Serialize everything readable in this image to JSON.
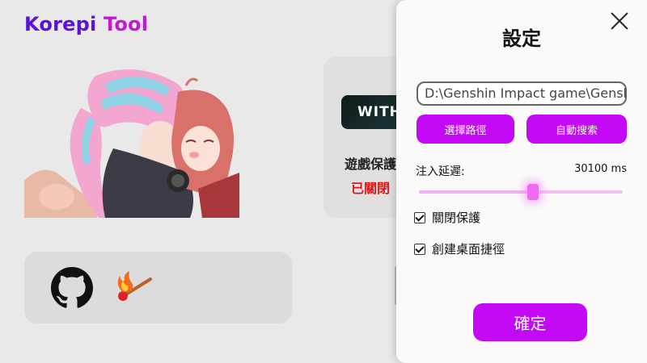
{
  "app": {
    "title_part1": "Korepi",
    "title_part2": "Tool"
  },
  "main": {
    "status_badge": "WITH",
    "status_label": "遊戲保護",
    "status_value": "已關閉"
  },
  "links": {
    "github_icon": "github-icon",
    "match_icon": "match-icon"
  },
  "settings": {
    "title": "設定",
    "path_value": "D:\\Genshin Impact game\\Genshin",
    "browse_label": "選擇路徑",
    "auto_search_label": "自動搜索",
    "delay_label": "注入延遲:",
    "delay_value": "30100 ms",
    "delay_fraction": 0.56,
    "disable_protection_label": "關閉保護",
    "disable_protection_checked": true,
    "create_shortcut_label": "創建桌面捷徑",
    "create_shortcut_checked": true,
    "confirm_label": "確定"
  },
  "colors": {
    "accent": "#c409f5",
    "title_purple": "#5b12d9",
    "title_magenta": "#c418d6",
    "status_red": "#e01616"
  }
}
